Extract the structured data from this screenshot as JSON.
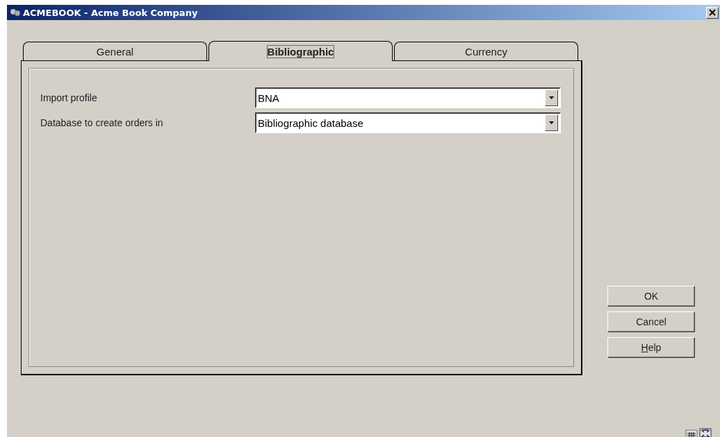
{
  "window": {
    "title": "ACMEBOOK - Acme Book Company"
  },
  "tabs": [
    {
      "label": "General",
      "selected": false
    },
    {
      "label": "Bibliographic",
      "selected": true
    },
    {
      "label": "Currency",
      "selected": false
    }
  ],
  "fields": [
    {
      "label": "Import profile",
      "value": "BNA"
    },
    {
      "label": "Database to create orders in",
      "value": "Bibliographic database"
    }
  ],
  "buttons": [
    {
      "label": "OK",
      "first_letter_underlined": false
    },
    {
      "label": "Cancel",
      "first_letter_underlined": false
    },
    {
      "label": "Help",
      "first_letter_underlined": true
    }
  ]
}
